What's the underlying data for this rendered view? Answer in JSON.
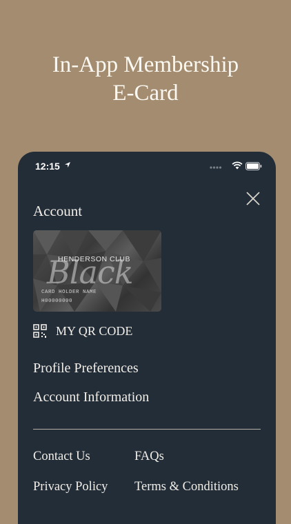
{
  "headline": {
    "line1": "In-App Membership",
    "line2": "E-Card"
  },
  "status_bar": {
    "time": "12:15"
  },
  "menu": {
    "section_title": "Account",
    "card": {
      "club_name": "HENDERSON CLUB",
      "script_text": "Black",
      "holder_label": "CARD HOLDER NAME",
      "member_number": "H00000000"
    },
    "qr_code_label": "MY QR CODE",
    "items": [
      "Profile Preferences",
      "Account Information"
    ],
    "footer_links": {
      "contact": "Contact Us",
      "faqs": "FAQs",
      "privacy": "Privacy Policy",
      "terms": "Terms & Conditions"
    }
  },
  "colors": {
    "background": "#a38c6f",
    "panel": "#232d38",
    "text": "#f2efe9"
  },
  "icons": [
    "location-arrow-icon",
    "signal-icon",
    "wifi-icon",
    "battery-icon",
    "close-icon",
    "qr-code-icon"
  ]
}
